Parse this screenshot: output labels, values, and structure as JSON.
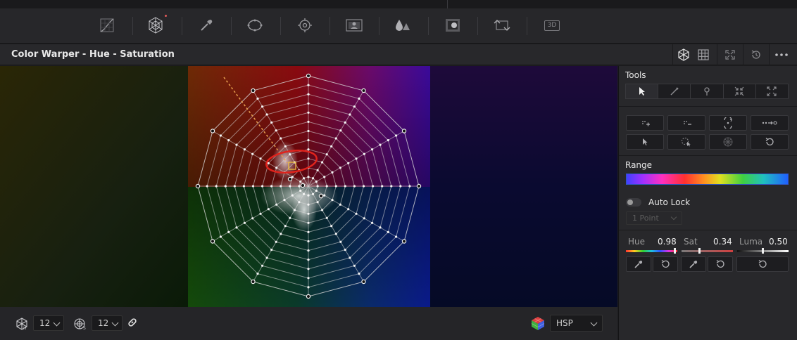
{
  "toolbar": {
    "icons": [
      "curves-icon",
      "color-warper-icon",
      "eyedropper-icon",
      "window-icon",
      "tracker-icon",
      "magic-mask-icon",
      "blur-icon",
      "key-icon",
      "resize-icon",
      "3d-icon"
    ],
    "label_3d": "3D"
  },
  "header": {
    "title": "Color Warper - Hue - Saturation",
    "icons": [
      "mesh-view-icon",
      "grid-view-icon",
      "fullscreen-icon",
      "reset-icon",
      "more-options-icon"
    ]
  },
  "footer": {
    "hue_points_value": "12",
    "sat_points_value": "12",
    "color_space_value": "HSP"
  },
  "panel": {
    "tools_label": "Tools",
    "tool_icons": [
      "select-arrow-icon",
      "pen-icon",
      "pin-icon",
      "contract-icon",
      "expand-icon"
    ],
    "range_label": "Range",
    "auto_lock_label": "Auto Lock",
    "points_select_value": "1 Point",
    "hue_label": "Hue",
    "hue_value": "0.98",
    "sat_label": "Sat",
    "sat_value": "0.34",
    "luma_label": "Luma",
    "luma_value": "0.50"
  },
  "colors": {
    "accent_blue": "#2e56c6",
    "selection_red": "#e0231c",
    "guide_orange": "#e8a050"
  }
}
